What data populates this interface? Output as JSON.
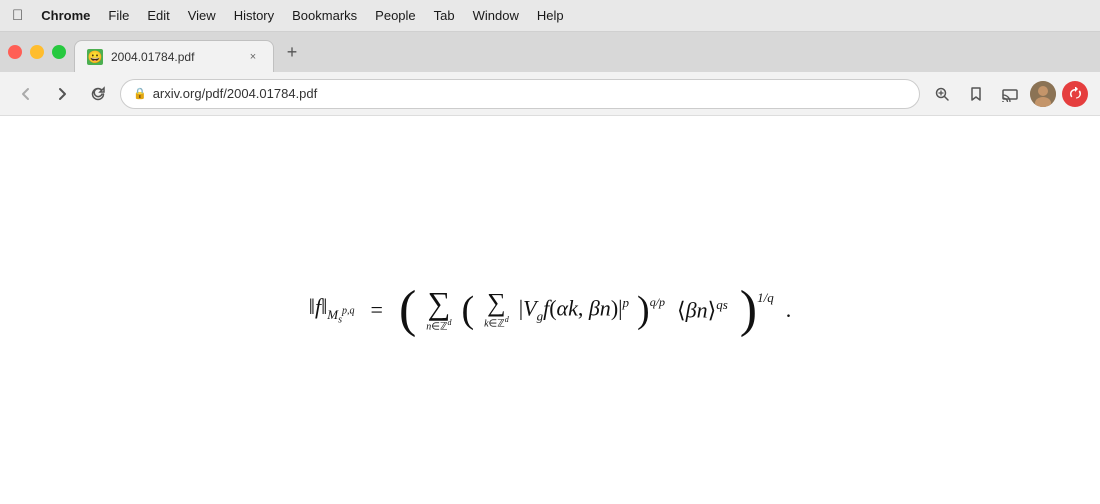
{
  "menubar": {
    "apple": "⌘",
    "items": [
      {
        "label": "Chrome",
        "bold": true
      },
      {
        "label": "File"
      },
      {
        "label": "Edit"
      },
      {
        "label": "View"
      },
      {
        "label": "History"
      },
      {
        "label": "Bookmarks"
      },
      {
        "label": "People"
      },
      {
        "label": "Tab"
      },
      {
        "label": "Window"
      },
      {
        "label": "Help"
      }
    ]
  },
  "tab": {
    "favicon": "😀",
    "title": "2004.01784.pdf",
    "close": "×"
  },
  "toolbar": {
    "back_title": "Back",
    "forward_title": "Forward",
    "reload_title": "Reload",
    "lock_icon": "🔒",
    "url": "arxiv.org/pdf/2004.01784.pdf",
    "search_icon": "🔍",
    "bookmark_icon": "☆",
    "cast_icon": "▭",
    "new_tab_plus": "+"
  },
  "math": {
    "norm_open": "‖f‖",
    "subscript": "M",
    "sub_s": "s",
    "sup_pq": "p,q",
    "equals": "=",
    "period": "."
  }
}
